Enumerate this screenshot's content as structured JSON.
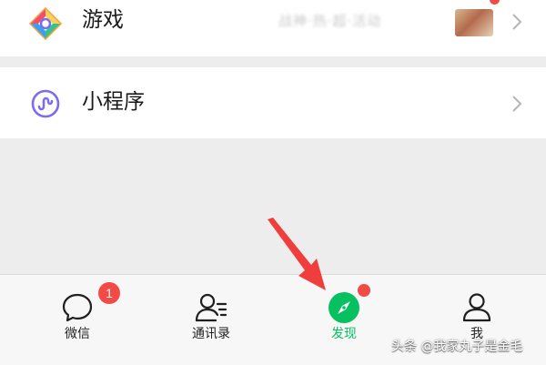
{
  "discover_list": {
    "items": [
      {
        "label": "游戏",
        "icon": "games-icon",
        "promo_text": "战神·热·超·活动",
        "promo_thumb": "promo-thumbnail",
        "has_red_dot": true
      },
      {
        "label": "小程序",
        "icon": "mini-program-icon"
      }
    ]
  },
  "tab_bar": {
    "tabs": [
      {
        "label": "微信",
        "icon": "chat-bubble-icon",
        "badge": "1"
      },
      {
        "label": "通讯录",
        "icon": "contacts-icon"
      },
      {
        "label": "发现",
        "icon": "compass-icon",
        "active": true,
        "red_dot": true
      },
      {
        "label": "我",
        "icon": "person-icon"
      }
    ]
  },
  "watermark": "头条 @我家丸子是金毛",
  "colors": {
    "accent_green": "#07c160",
    "badge_red": "#f24a45",
    "background": "#ededed",
    "annotation_arrow": "#f03e3e"
  }
}
